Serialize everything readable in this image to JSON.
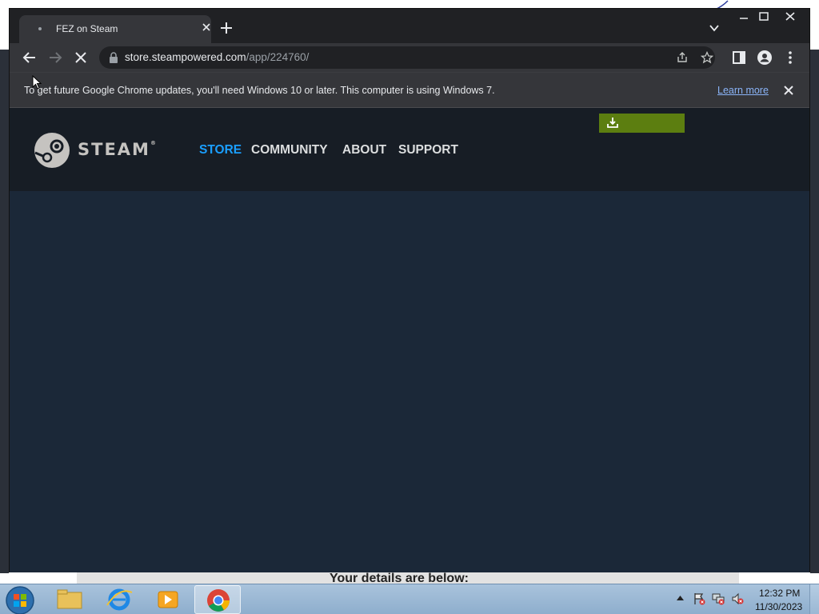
{
  "desktop": {
    "background_text": "Your details are below:"
  },
  "browser": {
    "tab": {
      "title": "FEZ on Steam"
    },
    "address": {
      "host": "store.steampowered.com",
      "path": "/app/224760/"
    },
    "infobar": {
      "message": "To get future Google Chrome updates, you'll need Windows 10 or later. This computer is using Windows 7.",
      "link": "Learn more"
    }
  },
  "steam": {
    "wordmark": "STEAM",
    "trademark": "®",
    "nav": [
      "STORE",
      "COMMUNITY",
      "ABOUT",
      "SUPPORT"
    ],
    "install_label": ""
  },
  "taskbar": {
    "time": "12:32 PM",
    "date": "11/30/2023"
  },
  "colors": {
    "steam_bg": "#1b2838",
    "steam_header": "#171d25",
    "nav_active": "#1a9fff",
    "install_green": "#5c7e10",
    "chrome_dark": "#202124",
    "chrome_toolbar": "#35363a"
  }
}
